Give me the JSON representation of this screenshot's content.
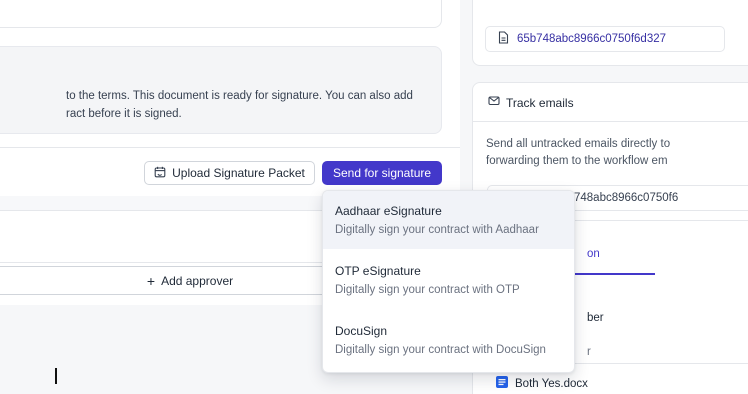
{
  "agreement": {
    "notice_line1": "to the terms. This document is ready for signature. You can also add",
    "notice_line2": "ract before it is signed."
  },
  "actions": {
    "upload_label": "Upload Signature Packet",
    "send_label": "Send for signature"
  },
  "approvers": {
    "add_label": "Add approver",
    "add_prefix": "+"
  },
  "sidebar": {
    "document_id": "65b748abc8966c0750f6d327",
    "track_emails": {
      "title": "Track emails",
      "desc_line1": "Send all untracked emails directly to",
      "desc_line2": "forwarding them to the workflow em",
      "email_fragment": "748abc8966c0750f6"
    },
    "tab_fragment": "on",
    "peek_text_1": "ber",
    "peek_text_2": "r",
    "file_name": "Both Yes.docx"
  },
  "signature_menu": {
    "options": [
      {
        "title": "Aadhaar eSignature",
        "description": "Digitally sign your contract with Aadhaar"
      },
      {
        "title": "OTP eSignature",
        "description": "Digitally sign your contract with OTP"
      },
      {
        "title": "DocuSign",
        "description": "Digitally sign your contract with DocuSign"
      }
    ],
    "highlighted_index": 0
  },
  "colors": {
    "primary": "#4338ca",
    "link": "#3730a3",
    "panel_bg": "#f4f5f7"
  },
  "icons": {
    "upload": "calendar-sync-icon",
    "document": "file-icon",
    "track": "mail-track-icon",
    "file": "docx-file-icon"
  }
}
